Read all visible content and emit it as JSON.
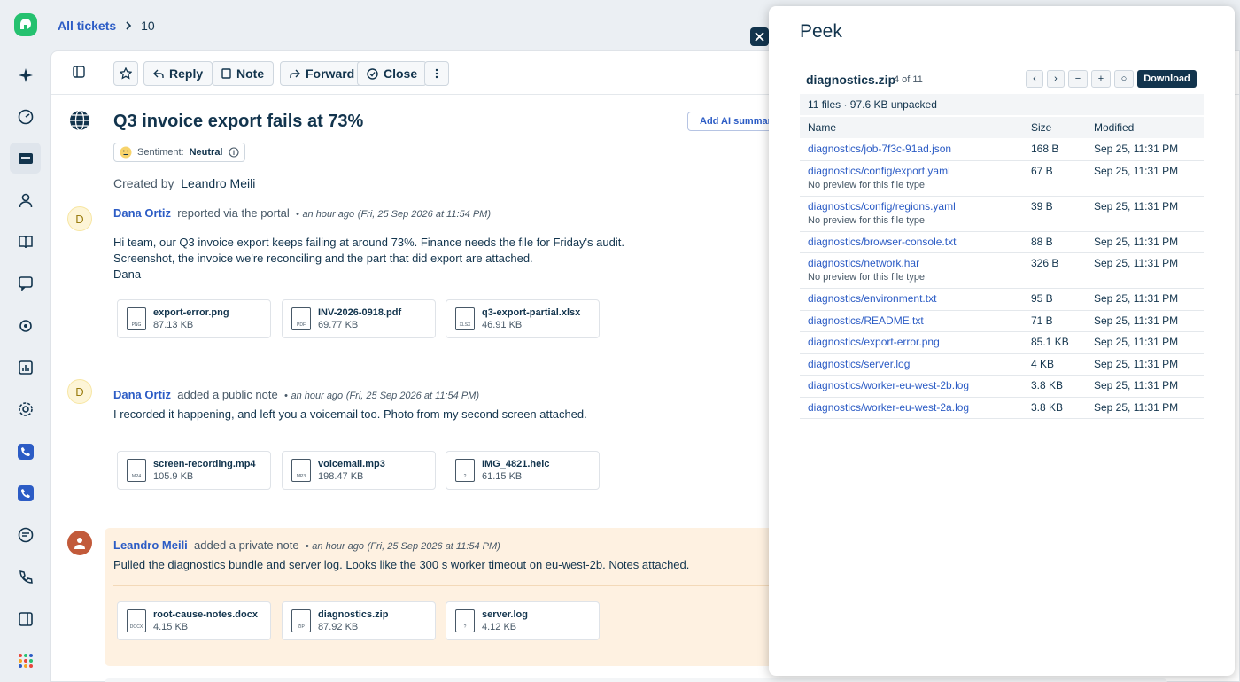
{
  "breadcrumb": {
    "all_tickets": "All tickets",
    "ticket_number": "10"
  },
  "toolbar": {
    "reply": "Reply",
    "note": "Note",
    "forward": "Forward",
    "close": "Close"
  },
  "ticket": {
    "title": "Q3 invoice export fails at 73%",
    "sentiment_label": "Sentiment:",
    "sentiment_value": "Neutral",
    "created_by_label": "Created by",
    "created_by_name": "Leandro Meili",
    "add_ai_summary": "Add AI summary"
  },
  "conversations": [
    {
      "avatar": "D",
      "author": "Dana Ortiz",
      "action": "reported via the portal",
      "dot": "•",
      "relative": "an hour ago",
      "absolute": "(Fri, 25 Sep 2026 at 11:54 PM)",
      "lines": [
        "Hi team, our Q3 invoice export keeps failing at around 73%. Finance needs the file for Friday's audit.",
        "Screenshot, the invoice we're reconciling and the part that did export are attached.",
        "Dana"
      ],
      "attachments": [
        {
          "name": "export-error.png",
          "size": "87.13 KB",
          "type": "PNG"
        },
        {
          "name": "INV-2026-0918.pdf",
          "size": "69.77 KB",
          "type": "PDF"
        },
        {
          "name": "q3-export-partial.xlsx",
          "size": "46.91 KB",
          "type": "XLSX"
        }
      ]
    },
    {
      "avatar": "D",
      "author": "Dana Ortiz",
      "action": "added a public note",
      "dot": "•",
      "relative": "an hour ago",
      "absolute": "(Fri, 25 Sep 2026 at 11:54 PM)",
      "lines": [
        "I recorded it happening, and left you a voicemail too. Photo from my second screen attached."
      ],
      "attachments": [
        {
          "name": "screen-recording.mp4",
          "size": "105.9 KB",
          "type": "MP4"
        },
        {
          "name": "voicemail.mp3",
          "size": "198.47 KB",
          "type": "MP3"
        },
        {
          "name": "IMG_4821.heic",
          "size": "61.15 KB",
          "type": "?"
        }
      ]
    },
    {
      "author": "Leandro Meili",
      "action": "added a private note",
      "dot": "•",
      "relative": "an hour ago",
      "absolute": "(Fri, 25 Sep 2026 at 11:54 PM)",
      "lines": [
        "Pulled the diagnostics bundle and server log. Looks like the 300 s worker timeout on eu-west-2b. Notes attached."
      ],
      "attachments": [
        {
          "name": "root-cause-notes.docx",
          "size": "4.15 KB",
          "type": "DOCX"
        },
        {
          "name": "diagnostics.zip",
          "size": "87.92 KB",
          "type": "ZIP"
        },
        {
          "name": "server.log",
          "size": "4.12 KB",
          "type": "?"
        }
      ]
    }
  ],
  "peek": {
    "title": "Peek",
    "file_name": "diagnostics.zip",
    "position": "4 of 11",
    "prev": "‹",
    "next": "›",
    "zoom_out": "−",
    "zoom_in": "+",
    "reset": "○",
    "download": "Download",
    "summary": "11 files · 97.6 KB unpacked",
    "columns": {
      "name": "Name",
      "size": "Size",
      "modified": "Modified"
    },
    "no_preview": "No preview for this file type",
    "files": [
      {
        "name": "diagnostics/job-7f3c-91ad.json",
        "size": "168 B",
        "modified": "Sep 25, 11:31 PM",
        "preview": true
      },
      {
        "name": "diagnostics/config/export.yaml",
        "size": "67 B",
        "modified": "Sep 25, 11:31 PM",
        "preview": false
      },
      {
        "name": "diagnostics/config/regions.yaml",
        "size": "39 B",
        "modified": "Sep 25, 11:31 PM",
        "preview": false
      },
      {
        "name": "diagnostics/browser-console.txt",
        "size": "88 B",
        "modified": "Sep 25, 11:31 PM",
        "preview": true
      },
      {
        "name": "diagnostics/network.har",
        "size": "326 B",
        "modified": "Sep 25, 11:31 PM",
        "preview": false
      },
      {
        "name": "diagnostics/environment.txt",
        "size": "95 B",
        "modified": "Sep 25, 11:31 PM",
        "preview": true
      },
      {
        "name": "diagnostics/README.txt",
        "size": "71 B",
        "modified": "Sep 25, 11:31 PM",
        "preview": true
      },
      {
        "name": "diagnostics/export-error.png",
        "size": "85.1 KB",
        "modified": "Sep 25, 11:31 PM",
        "preview": true
      },
      {
        "name": "diagnostics/server.log",
        "size": "4 KB",
        "modified": "Sep 25, 11:31 PM",
        "preview": true
      },
      {
        "name": "diagnostics/worker-eu-west-2b.log",
        "size": "3.8 KB",
        "modified": "Sep 25, 11:31 PM",
        "preview": true
      },
      {
        "name": "diagnostics/worker-eu-west-2a.log",
        "size": "3.8 KB",
        "modified": "Sep 25, 11:31 PM",
        "preview": true
      }
    ]
  },
  "colors": {
    "accent": "#2c5cc5",
    "text": "#12344d",
    "private_note": "#fef1e1",
    "brand_green": "#25c16f"
  }
}
